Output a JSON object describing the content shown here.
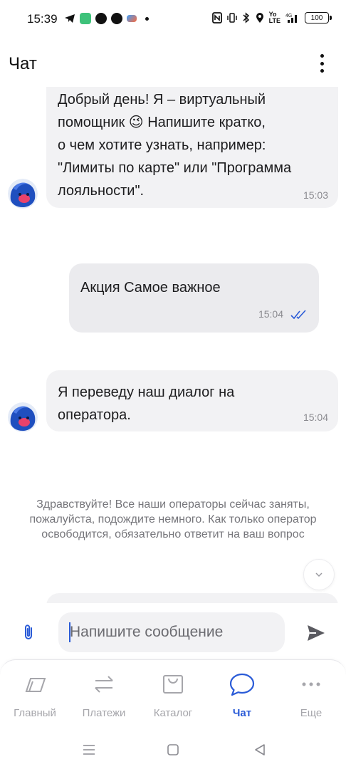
{
  "status_bar": {
    "time": "15:39",
    "battery": "100",
    "network": "4G"
  },
  "header": {
    "title": "Чат"
  },
  "messages": [
    {
      "from": "bot",
      "lines": [
        "Добрый день! Я – виртуальный",
        "помощник 😉 Напишите кратко,",
        "о чем хотите узнать, например:",
        "\"Лимиты по карте\" или \"Программа",
        "лояльности\"."
      ],
      "time": "15:03"
    },
    {
      "from": "user",
      "text": "Акция Самое важное",
      "time": "15:04"
    },
    {
      "from": "bot",
      "lines": [
        "Я переведу наш диалог на",
        "оператора."
      ],
      "time": "15:04"
    }
  ],
  "system_message": "Здравствуйте! Все наши операторы сейчас заняты, пожалуйста, подождите немного. Как только оператор освободится, обязательно ответит на ваш вопрос",
  "composer": {
    "placeholder": "Напишите сообщение",
    "value": ""
  },
  "bottom_nav": {
    "items": [
      {
        "label": "Главный",
        "icon": "home-card-icon",
        "active": false
      },
      {
        "label": "Платежи",
        "icon": "transfer-arrows-icon",
        "active": false
      },
      {
        "label": "Каталог",
        "icon": "shopping-bag-icon",
        "active": false
      },
      {
        "label": "Чат",
        "icon": "chat-bubble-icon",
        "active": true
      },
      {
        "label": "Еще",
        "icon": "more-dots-icon",
        "active": false
      }
    ]
  },
  "colors": {
    "accent": "#2a5bd7",
    "bubble_bg": "#f2f2f4",
    "inactive": "#a6a6ab"
  }
}
